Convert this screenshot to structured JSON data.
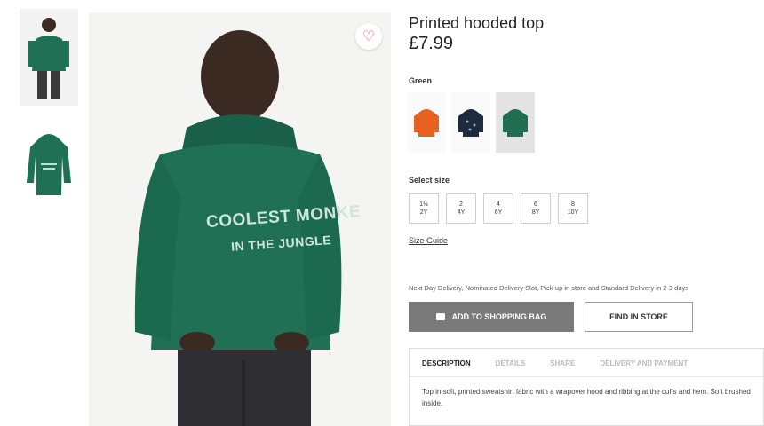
{
  "product": {
    "title": "Printed hooded top",
    "price": "£7.99",
    "color_label": "Green",
    "print_line1": "COOLEST MONKE",
    "print_line2": "IN THE JUNGLE"
  },
  "swatches": [
    {
      "color": "#e8621f"
    },
    {
      "color": "#1e2a3d"
    },
    {
      "color": "#1f6e52"
    }
  ],
  "size": {
    "label": "Select size",
    "options": [
      {
        "top": "1½",
        "bottom": "2Y"
      },
      {
        "top": "2",
        "bottom": "4Y"
      },
      {
        "top": "4",
        "bottom": "6Y"
      },
      {
        "top": "6",
        "bottom": "8Y"
      },
      {
        "top": "8",
        "bottom": "10Y"
      }
    ],
    "guide": "Size Guide"
  },
  "delivery_text": "Next Day Delivery, Nominated Delivery Slot, Pick-up in store and Standard Delivery in 2-3 days",
  "buttons": {
    "add_to_bag": "ADD TO SHOPPING BAG",
    "find_in_store": "FIND IN STORE"
  },
  "tabs": [
    "DESCRIPTION",
    "DETAILS",
    "SHARE",
    "DELIVERY AND PAYMENT"
  ],
  "description": "Top in soft, printed sweatshirt fabric with a wrapover hood and ribbing at the cuffs and hem. Soft brushed inside.",
  "colors": {
    "hoodie": "#1f7055",
    "accent": "#7a7a7a"
  }
}
